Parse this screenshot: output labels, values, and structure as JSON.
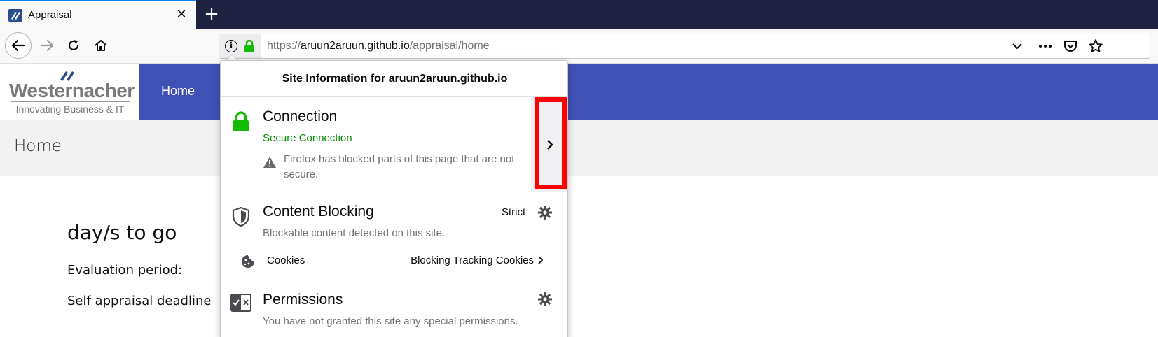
{
  "browser": {
    "tab": {
      "title": "Appraisal",
      "close_glyph": "✕"
    },
    "new_tab_glyph": "+",
    "url": {
      "scheme": "https://",
      "host": "aruun2aruun.github.io",
      "path": "/appraisal/home"
    },
    "icons": {
      "back": "back-arrow-icon",
      "forward": "forward-arrow-icon",
      "reload": "reload-icon",
      "home": "home-icon",
      "info": "info-icon",
      "lock": "lock-icon",
      "dropdown": "chevron-down-icon",
      "more": "more-icon",
      "pocket": "pocket-icon",
      "bookmark": "star-icon"
    }
  },
  "page": {
    "logo": {
      "name": "Westernacher",
      "tagline": "Innovating Business & IT"
    },
    "nav": {
      "home": "Home"
    },
    "breadcrumb": "Home",
    "countdown": "day/s to go",
    "evaluation_period": "Evaluation period:",
    "self_appraisal_deadline": "Self appraisal deadline"
  },
  "popup": {
    "header": "Site Information for aruun2aruun.github.io",
    "connection": {
      "title": "Connection",
      "status": "Secure Connection",
      "warning": "Firefox has blocked parts of this page that are not secure."
    },
    "content_blocking": {
      "title": "Content Blocking",
      "level": "Strict",
      "description": "Blockable content detected on this site.",
      "cookies_label": "Cookies",
      "cookies_status": "Blocking Tracking Cookies"
    },
    "permissions": {
      "title": "Permissions",
      "description": "You have not granted this site any special permissions."
    }
  },
  "colors": {
    "accent": "#3f51b5",
    "secure": "#058b00",
    "highlight": "#ff0000",
    "tabstrip": "#1f2240"
  }
}
